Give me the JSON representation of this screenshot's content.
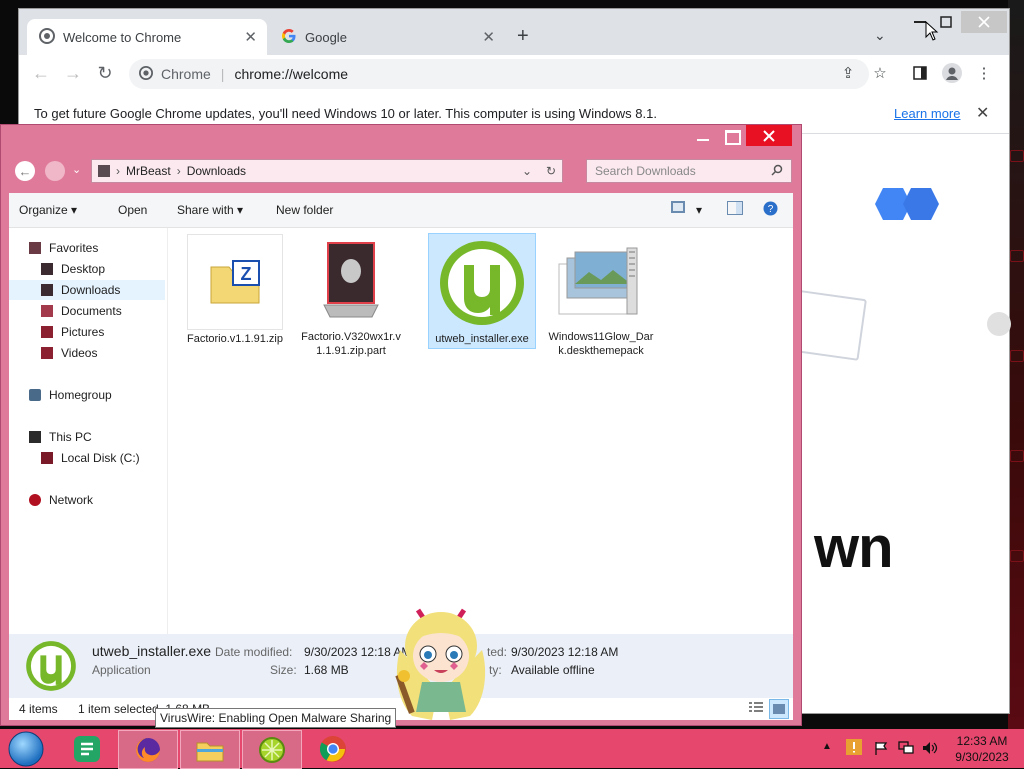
{
  "chrome": {
    "tabs": [
      {
        "label": "Welcome to Chrome",
        "icon": "chrome-icon"
      },
      {
        "label": "Google",
        "icon": "google-g-icon"
      }
    ],
    "address_label": "Chrome",
    "url": "chrome://welcome",
    "infobar": {
      "message": "To get future Google Chrome updates, you'll need Windows 10 or later. This computer is using Windows 8.1.",
      "link": "Learn more"
    },
    "page_heading_fragment": "wn"
  },
  "explorer": {
    "breadcrumb": [
      "MrBeast",
      "Downloads"
    ],
    "search_placeholder": "Search Downloads",
    "commands": {
      "organize": "Organize",
      "open": "Open",
      "share_with": "Share with",
      "new_folder": "New folder"
    },
    "nav": {
      "favorites": "Favorites",
      "desktop": "Desktop",
      "downloads": "Downloads",
      "documents": "Documents",
      "pictures": "Pictures",
      "videos": "Videos",
      "homegroup": "Homegroup",
      "this_pc": "This PC",
      "local_disk": "Local Disk (C:)",
      "network": "Network"
    },
    "files": [
      {
        "name": "Factorio.v1.1.91.zip",
        "icon": "zip-archive-icon"
      },
      {
        "name": "Factorio.V320wx1r.v1.1.91.zip.part",
        "icon": "alienware-file-icon"
      },
      {
        "name": "utweb_installer.exe",
        "icon": "utorrent-icon",
        "selected": true
      },
      {
        "name": "Windows11Glow_Dark.deskthemepack",
        "icon": "themepack-icon"
      }
    ],
    "details": {
      "name": "utweb_installer.exe",
      "type": "Application",
      "date_modified_label": "Date modified:",
      "date_modified": "9/30/2023 12:18 AM",
      "size_label": "Size:",
      "size": "1.68 MB",
      "created_label_fragment": "ted:",
      "created": "9/30/2023 12:18 AM",
      "availability_label_fragment": "ty:",
      "availability": "Available offline"
    },
    "status": {
      "items": "4 items",
      "selected": "1 item selected  1.68 MB"
    }
  },
  "tooltip": "VirusWire: Enabling Open Malware Sharing",
  "taskbar": {
    "apps": [
      "start-orb-icon",
      "google-docs-icon",
      "firefox-icon",
      "file-explorer-icon",
      "lime-app-icon",
      "chrome-icon"
    ],
    "clock_time": "12:33 AM",
    "clock_date": "9/30/2023"
  },
  "colors": {
    "explorer_frame": "#e07a9a",
    "taskbar": "#e5476d",
    "selection": "#cce8ff",
    "close_red": "#e81123"
  }
}
